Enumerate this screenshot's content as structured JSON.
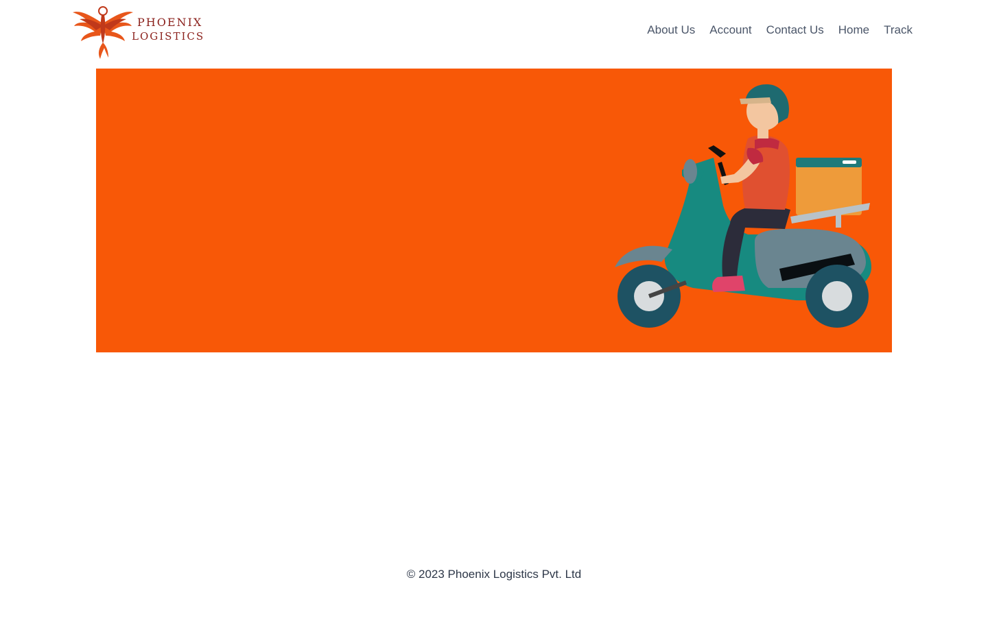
{
  "brand": {
    "line1": "PHOENIX",
    "line2": "LOGISTICS",
    "icon": "phoenix-bird-logo",
    "color": "#8a1f1a",
    "accent": "#e8561a"
  },
  "nav": {
    "items": [
      {
        "label": "About Us"
      },
      {
        "label": "Account"
      },
      {
        "label": "Contact Us"
      },
      {
        "label": "Home"
      },
      {
        "label": "Track"
      }
    ]
  },
  "hero": {
    "background": "#f85807",
    "illustration": "delivery-scooter-rider"
  },
  "footer": {
    "copyright": "© 2023 Phoenix Logistics Pvt. Ltd"
  }
}
